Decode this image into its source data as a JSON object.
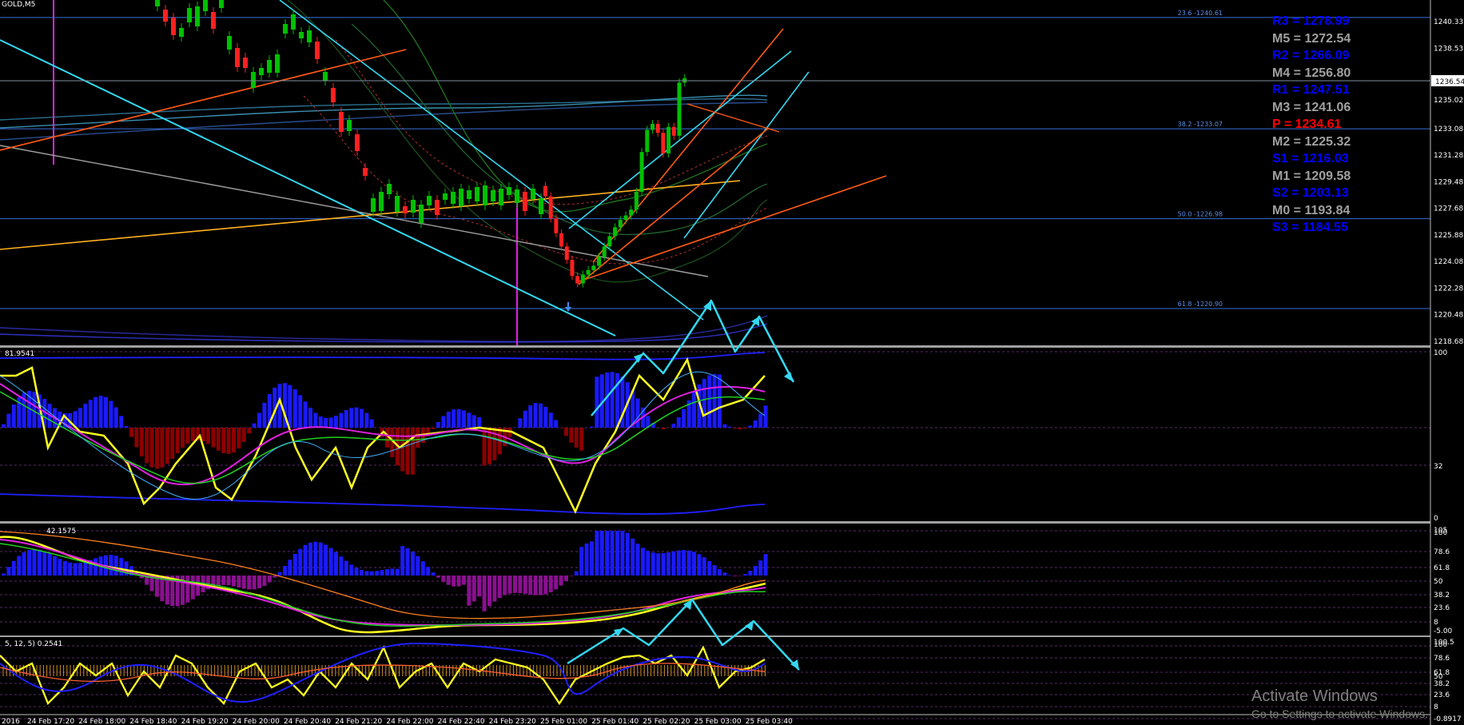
{
  "window": {
    "symbol_label": "GOLD,M5"
  },
  "price_axis": {
    "min": 1218.68,
    "max": 1242.1,
    "labels": [
      "1240.33",
      "1238.53",
      "1236.54",
      "1235.02",
      "1233.08",
      "1231.28",
      "1229.48",
      "1227.68",
      "1225.88",
      "1224.08",
      "1222.28",
      "1220.48",
      "1218.68"
    ],
    "current_price": "1236.54"
  },
  "fibonacci": [
    {
      "label": "23.6 -1240.61",
      "price": 1240.61
    },
    {
      "label": "38.2 -1233.07",
      "price": 1233.07
    },
    {
      "label": "50.0 -1226.98",
      "price": 1226.98
    },
    {
      "label": "61.8 -1220.90",
      "price": 1220.9
    }
  ],
  "pivot_levels": [
    {
      "label": "R3 = 1278.99",
      "color": "#0000ff"
    },
    {
      "label": "M5 = 1272.54",
      "color": "#a0a0a0"
    },
    {
      "label": "R2 = 1266.09",
      "color": "#0000ff"
    },
    {
      "label": "M4 = 1256.80",
      "color": "#a0a0a0"
    },
    {
      "label": "R1 = 1247.51",
      "color": "#0000ff"
    },
    {
      "label": "M3 = 1241.06",
      "color": "#a0a0a0"
    },
    {
      "label": "P  = 1234.61",
      "color": "#ff0000"
    },
    {
      "label": "M2 = 1225.32",
      "color": "#a0a0a0"
    },
    {
      "label": "S1 = 1216.03",
      "color": "#0000ff"
    },
    {
      "label": "M1 = 1209.58",
      "color": "#a0a0a0"
    },
    {
      "label": "S2 = 1203.13",
      "color": "#0000ff"
    },
    {
      "label": "M0 = 1193.84",
      "color": "#a0a0a0"
    },
    {
      "label": "S3 = 1184.55",
      "color": "#0000ff"
    }
  ],
  "indicator1": {
    "header": "81.9541",
    "scale_labels": [
      "100",
      "32",
      "0"
    ]
  },
  "indicator2": {
    "header": "42.1575",
    "scale_labels": [
      "105",
      "100",
      "78.6",
      "61.8",
      "50",
      "38.2",
      "23.6",
      "8",
      "-5.00"
    ]
  },
  "indicator3": {
    "header": "5, 12, 5) 0.2541",
    "scale_labels": [
      "100.5",
      "100",
      "78.6",
      "61.8",
      "50",
      "38.2",
      "23.6",
      "8",
      "-0.8917"
    ]
  },
  "time_axis": [
    "2016",
    "24 Feb 17:20",
    "24 Feb 18:00",
    "24 Feb 18:40",
    "24 Feb 19:20",
    "24 Feb 20:00",
    "24 Feb 20:40",
    "24 Feb 21:20",
    "24 Feb 22:00",
    "24 Feb 22:40",
    "24 Feb 23:20",
    "25 Feb 01:00",
    "25 Feb 01:40",
    "25 Feb 02:20",
    "25 Feb 03:00",
    "25 Feb 03:40"
  ],
  "watermark": {
    "title": "Activate Windows",
    "subtitle": "Go to Settings to activate Windows."
  },
  "colors": {
    "background": "#000000",
    "bull": "#00c000",
    "bear": "#ff2020",
    "fib": "#3a6fd8",
    "cyan": "#33d8f0",
    "orange": "#ff5a14",
    "magenta": "#e020e0",
    "yellow": "#ffff20",
    "blue": "#1a1aff",
    "darkred": "#8b0000",
    "purple": "#8a1090"
  },
  "chart_data": {
    "type": "candlestick",
    "symbol": "GOLD",
    "timeframe": "M5",
    "close": [
      1240.9,
      1240.1,
      1238.9,
      1238.2,
      1239.1,
      1238.6,
      1237.8,
      1236.9,
      1235.7,
      1234.4,
      1232.7,
      1231.2,
      1229.9,
      1229.1,
      1228.7,
      1228.4,
      1228.9,
      1229.3,
      1229.0,
      1229.4,
      1229.6,
      1229.3,
      1229.1,
      1229.2,
      1228.5,
      1227.0,
      1226.0,
      1225.1,
      1224.2,
      1223.1,
      1222.6,
      1223.2,
      1223.5,
      1223.8,
      1224.4,
      1225.1,
      1225.8,
      1226.4,
      1226.9,
      1227.2,
      1227.6,
      1228.8,
      1231.5,
      1233.0,
      1233.4,
      1232.8,
      1231.4,
      1233.2,
      1232.6,
      1236.2,
      1236.5
    ]
  }
}
